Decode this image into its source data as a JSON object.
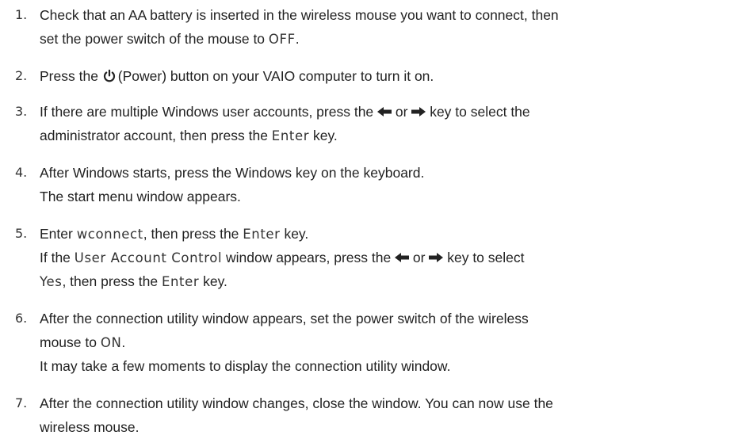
{
  "steps": [
    {
      "num": "1.",
      "line1_a": "Check that an AA battery is inserted in the wireless mouse you want to connect, then",
      "line2_a": "set the power switch of the mouse to ",
      "line2_sys": "OFF",
      "line2_b": "."
    },
    {
      "num": "2.",
      "a": "Press the ",
      "icon": "power-icon",
      "b": "(Power) button on your VAIO computer to turn it on."
    },
    {
      "num": "3.",
      "line1_a": "If there are multiple Windows user accounts, press the ",
      "left_icon": "left-arrow-key-icon",
      "line1_or": " or ",
      "right_icon": "right-arrow-key-icon",
      "line1_b": " key to select the",
      "line2_a": "administrator account, then press the ",
      "line2_sys": "Enter",
      "line2_b": " key."
    },
    {
      "num": "4.",
      "line1": "After Windows starts, press the Windows key on the keyboard.",
      "line2": "The start menu window appears."
    },
    {
      "num": "5.",
      "line1_a": "Enter ",
      "line1_sys1": "wconnect",
      "line1_b": ", then press the ",
      "line1_sys2": "Enter",
      "line1_c": " key.",
      "line2_a": "If the ",
      "line2_sys": "User Account Control",
      "line2_b": " window appears, press the ",
      "line2_or": " or ",
      "line2_c": " key to select",
      "line3_sys1": "Yes",
      "line3_a": ", then press the ",
      "line3_sys2": "Enter",
      "line3_b": " key."
    },
    {
      "num": "6.",
      "line1": "After the connection utility window appears, set the power switch of the wireless",
      "line2_a": "mouse to ",
      "line2_sys": "ON",
      "line2_b": ".",
      "line3": "It may take a few moments to display the connection utility window."
    },
    {
      "num": "7.",
      "line1": "After the connection utility window changes, close the window. You can now use the",
      "line2": "wireless mouse."
    }
  ]
}
